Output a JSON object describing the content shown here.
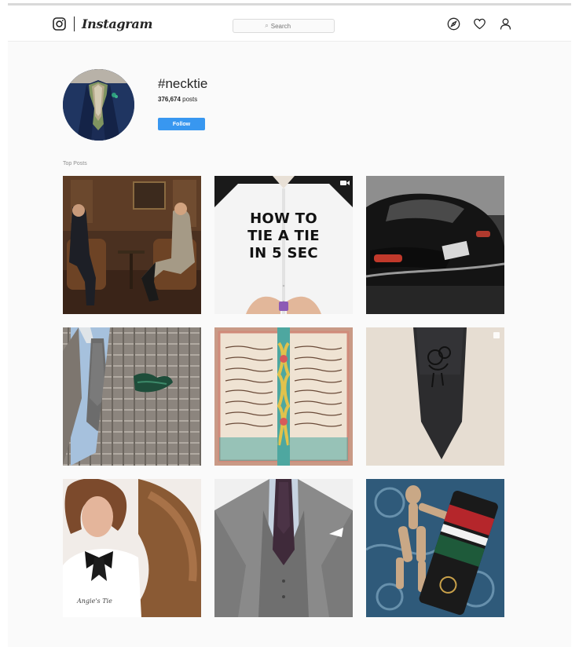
{
  "app": {
    "wordmark": "Instagram"
  },
  "search": {
    "placeholder": "Search"
  },
  "nav": {
    "icons": [
      "compass-icon",
      "heart-icon",
      "user-icon"
    ]
  },
  "hashtag": {
    "title": "#necktie",
    "posts_count": "376,674",
    "posts_suffix": "posts",
    "follow_label": "Follow"
  },
  "section": {
    "top_posts_label": "Top Posts"
  },
  "posts": [
    {
      "type": "photo"
    },
    {
      "type": "video",
      "caption_lines": [
        "HOW TO",
        "TIE A TIE",
        "IN 5 SEC"
      ]
    },
    {
      "type": "photo"
    },
    {
      "type": "photo"
    },
    {
      "type": "photo"
    },
    {
      "type": "carousel"
    },
    {
      "type": "photo",
      "watermark": "Angie's Tie"
    },
    {
      "type": "photo"
    },
    {
      "type": "photo"
    }
  ],
  "colors": {
    "follow": "#3897f0",
    "background": "#fafafa",
    "text": "#262626"
  }
}
